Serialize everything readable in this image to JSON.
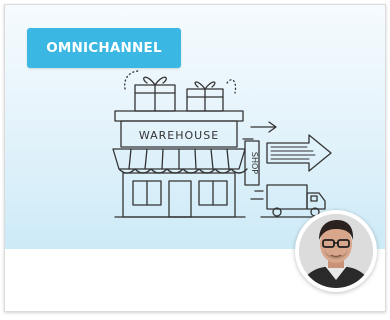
{
  "card": {
    "badge_label": "OMNICHANNEL",
    "illustration": {
      "icon": "warehouse-to-shop-icon",
      "sign_text": "WAREHOUSE",
      "shop_sign_text": "SHOP"
    },
    "author_avatar_icon": "author-avatar-photo"
  },
  "colors": {
    "badge_background": "#3ab8e3",
    "hero_gradient_top": "#f6fbfe",
    "hero_gradient_bottom": "#cdeaf7"
  }
}
